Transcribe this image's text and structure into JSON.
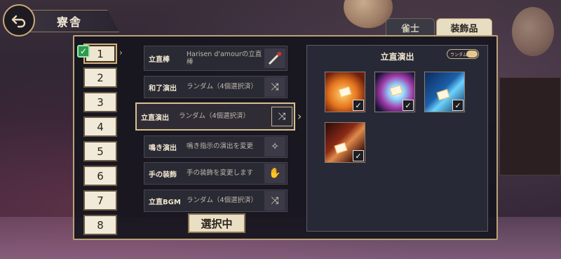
{
  "header": {
    "title": "寮舎",
    "back_icon": "back-arrow-icon"
  },
  "tabs": [
    {
      "label": "雀士",
      "selected": false
    },
    {
      "label": "装飾品",
      "selected": true
    }
  ],
  "slots": [
    {
      "label": "1",
      "active": true,
      "checked": true
    },
    {
      "label": "2"
    },
    {
      "label": "3"
    },
    {
      "label": "4"
    },
    {
      "label": "5"
    },
    {
      "label": "6"
    },
    {
      "label": "7"
    },
    {
      "label": "8"
    }
  ],
  "rows": [
    {
      "label": "立直棒",
      "value": "Harisen d'amourの立直棒",
      "icon": "stick-icon"
    },
    {
      "label": "和了演出",
      "value": "ランダム（4個選択済）",
      "icon": "shuffle-icon"
    },
    {
      "label": "立直演出",
      "value": "ランダム（4個選択済）",
      "icon": "shuffle-icon",
      "active": true
    },
    {
      "label": "鳴き演出",
      "value": "鳴き指示の演出を変更",
      "icon": "sparkle-icon"
    },
    {
      "label": "手の装飾",
      "value": "手の装飾を変更します",
      "icon": "hand-icon"
    },
    {
      "label": "立直BGM",
      "value": "ランダム（4個選択済）",
      "icon": "shuffle-icon"
    }
  ],
  "select_button": "選択中",
  "preview": {
    "title": "立直演出",
    "toggle_label": "ランダム",
    "toggle_on": true,
    "tiles": [
      {
        "name": "flame-effect",
        "checked": true
      },
      {
        "name": "cosmic-effect",
        "checked": true
      },
      {
        "name": "ice-blade-effect",
        "checked": true
      },
      {
        "name": "crimson-slash-effect",
        "checked": true
      }
    ]
  }
}
